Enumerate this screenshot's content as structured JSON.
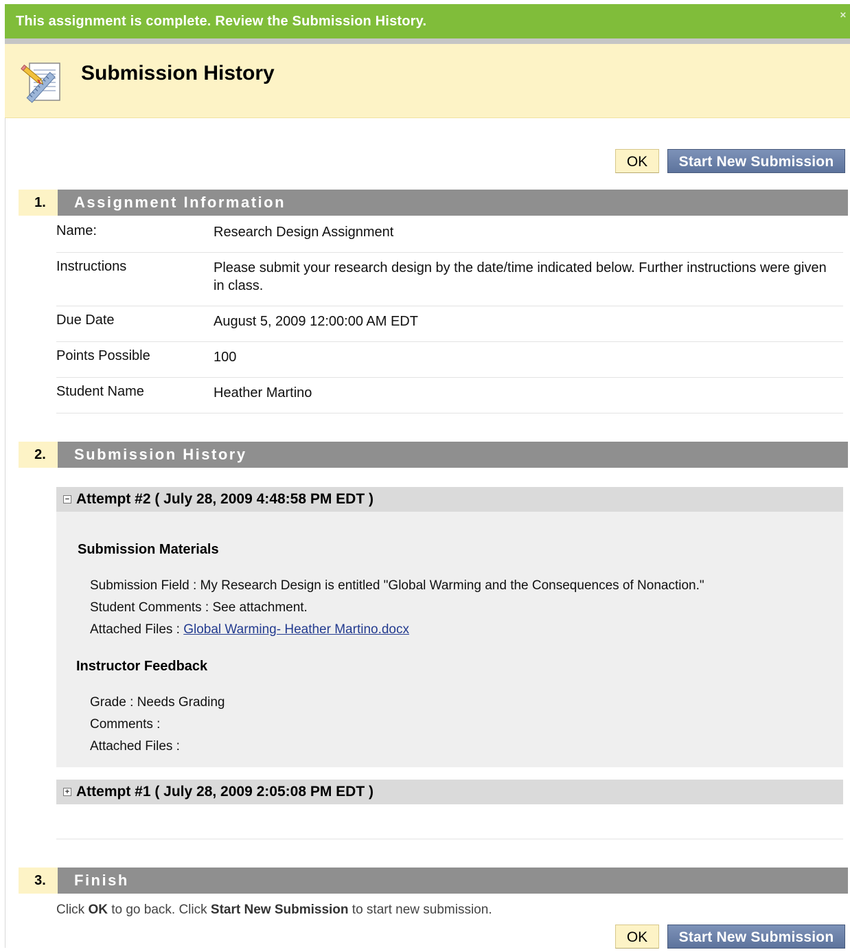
{
  "banner": {
    "message": "This assignment is complete. Review the Submission History.",
    "close_glyph": "✕"
  },
  "header": {
    "title": "Submission History",
    "icon": "assignment-pencil-ruler-icon"
  },
  "buttons": {
    "ok": "OK",
    "start_new": "Start New Submission"
  },
  "sections": [
    {
      "number": "1.",
      "title": "Assignment Information"
    },
    {
      "number": "2.",
      "title": "Submission History"
    },
    {
      "number": "3.",
      "title": "Finish"
    }
  ],
  "assignment_info": {
    "name": {
      "label": "Name:",
      "value": "Research Design Assignment"
    },
    "instructions": {
      "label": "Instructions",
      "value": "Please submit your research design by the date/time indicated below. Further instructions were given in class."
    },
    "due_date": {
      "label": "Due Date",
      "value": "August 5, 2009 12:00:00 AM EDT"
    },
    "points": {
      "label": "Points Possible",
      "value": "100"
    },
    "student": {
      "label": "Student Name",
      "value": "Heather Martino"
    }
  },
  "attempts": [
    {
      "title": "Attempt #2 ( July 28, 2009 4:48:58 PM EDT )",
      "toggle": "−",
      "expanded": true,
      "materials_heading": "Submission Materials",
      "submission_field_label": "Submission Field : ",
      "submission_field_value": "My Research Design is entitled \"Global Warming and the Consequences of Nonaction.\"",
      "student_comments_label": "Student Comments : ",
      "student_comments_value": "See attachment.",
      "attached_files_label": "Attached Files : ",
      "attached_file_name": "Global Warming- Heather Martino.docx",
      "feedback_heading": "Instructor Feedback",
      "grade_label": "Grade : ",
      "grade_value": "Needs Grading",
      "comments_label": "Comments :",
      "feedback_files_label": "Attached Files :"
    },
    {
      "title": "Attempt #1 ( July 28, 2009 2:05:08 PM EDT )",
      "toggle": "+",
      "expanded": false
    }
  ],
  "finish": {
    "part1": "Click ",
    "ok_bold": "OK",
    "part2": " to go back. Click ",
    "start_bold": "Start New Submission",
    "part3": " to start new submission."
  }
}
